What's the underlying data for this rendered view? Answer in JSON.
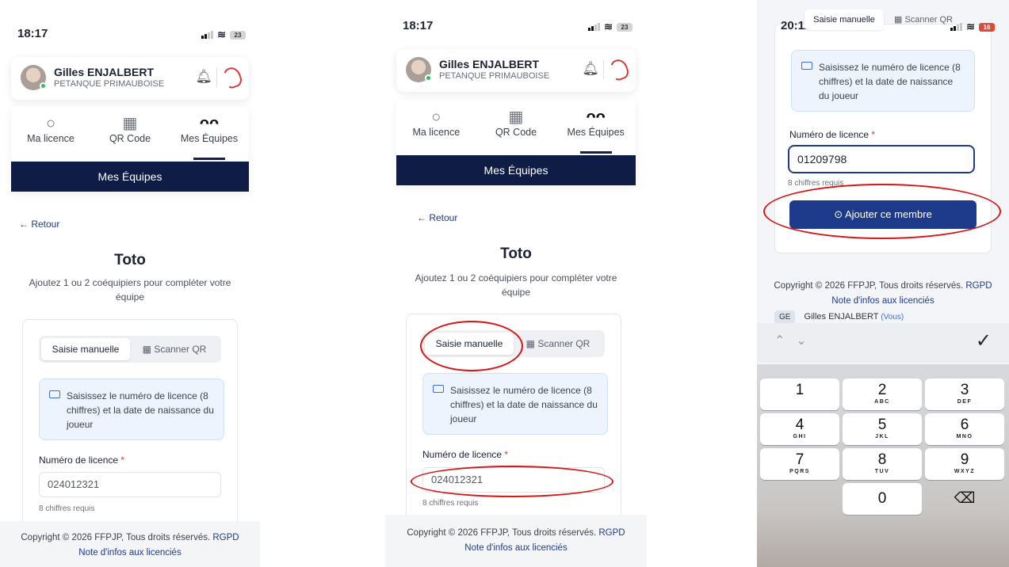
{
  "panel1": {
    "status": {
      "time": "18:17",
      "battery": "23"
    },
    "profile": {
      "name": "Gilles ENJALBERT",
      "club": "PETANQUE PRIMAUBOISE"
    },
    "tabs": [
      {
        "label": "Ma licence"
      },
      {
        "label": "QR Code"
      },
      {
        "label": "Mes Équipes"
      }
    ],
    "section_title": "Mes Équipes",
    "back": "← Retour",
    "team_name": "Toto",
    "subtitle": "Ajoutez 1 ou 2 coéquipiers pour compléter votre équipe",
    "mode": {
      "manual": "Saisie manuelle",
      "scan": "Scanner QR"
    },
    "info": "Saisissez le numéro de licence (8 chiffres) et la date de naissance du joueur",
    "licence_label": "Numéro de licence",
    "required_mark": "*",
    "licence_value": "024012321",
    "hint": "8 chiffres requis",
    "footer": {
      "copyright": "Copyright © 2026 FFPJP, Tous droits réservés.",
      "rgpd": "RGPD",
      "notice": "Note d'infos aux licenciés"
    }
  },
  "panel2": {
    "status": {
      "time": "18:17",
      "battery": "23"
    },
    "profile": {
      "name": "Gilles ENJALBERT",
      "club": "PETANQUE PRIMAUBOISE"
    },
    "tabs": [
      {
        "label": "Ma licence"
      },
      {
        "label": "QR Code"
      },
      {
        "label": "Mes Équipes"
      }
    ],
    "section_title": "Mes Équipes",
    "back": "← Retour",
    "team_name": "Toto",
    "subtitle": "Ajoutez 1 ou 2 coéquipiers pour compléter votre équipe",
    "mode": {
      "manual": "Saisie manuelle",
      "scan": "Scanner QR"
    },
    "info": "Saisissez le numéro de licence (8 chiffres) et la date de naissance du joueur",
    "licence_label": "Numéro de licence",
    "required_mark": "*",
    "licence_value": "024012321",
    "hint": "8 chiffres requis",
    "footer": {
      "copyright": "Copyright © 2026 FFPJP, Tous droits réservés.",
      "rgpd": "RGPD",
      "notice": "Note d'infos aux licenciés"
    }
  },
  "panel3": {
    "status": {
      "time": "20:11",
      "battery": "16"
    },
    "mode": {
      "manual": "Saisie manuelle",
      "scan": "Scanner QR"
    },
    "info": "Saisissez le numéro de licence (8 chiffres) et la date de naissance du joueur",
    "licence_label": "Numéro de licence",
    "required_mark": "*",
    "licence_value": "01209798",
    "hint": "8 chiffres requis",
    "add_button": "Ajouter ce membre",
    "footer": {
      "copyright": "Copyright © 2026 FFPJP, Tous droits réservés.",
      "rgpd": "RGPD",
      "notice": "Note d'infos aux licenciés"
    },
    "member": {
      "initials": "GE",
      "name": "Gilles ENJALBERT",
      "you": "(Vous)"
    },
    "keyboard": {
      "done": "✓",
      "keys": [
        {
          "n": "1",
          "l": ""
        },
        {
          "n": "2",
          "l": "ABC"
        },
        {
          "n": "3",
          "l": "DEF"
        },
        {
          "n": "4",
          "l": "GHI"
        },
        {
          "n": "5",
          "l": "JKL"
        },
        {
          "n": "6",
          "l": "MNO"
        },
        {
          "n": "7",
          "l": "PQRS"
        },
        {
          "n": "8",
          "l": "TUV"
        },
        {
          "n": "9",
          "l": "WXYZ"
        },
        {
          "n": "0",
          "l": ""
        },
        {
          "n": "⌫",
          "l": ""
        }
      ]
    }
  },
  "colors": {
    "brand_navy": "#0f1c45",
    "button_blue": "#1e3a8a",
    "annotation_red": "#d61515",
    "required_red": "#dd3333"
  }
}
